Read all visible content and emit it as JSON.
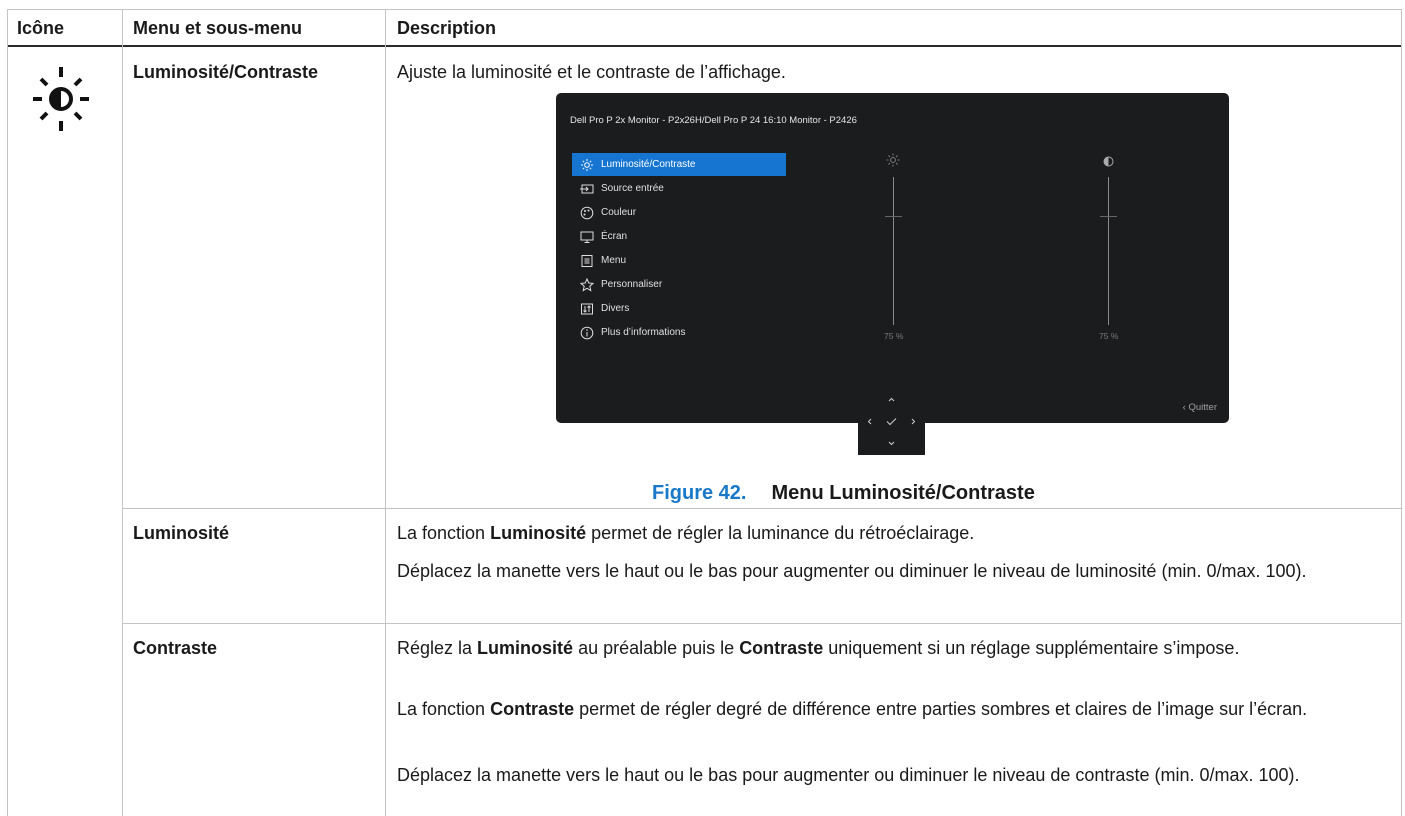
{
  "header": {
    "col_icon": "Icône",
    "col_menu": "Menu et sous-menu",
    "col_desc": "Description"
  },
  "row1": {
    "menu": "Luminosité/Contraste",
    "desc": "Ajuste la luminosité et le contraste de l’affichage.",
    "icon": "brightness-contrast-icon"
  },
  "osd": {
    "model": "Dell Pro P 2x Monitor - P2x26H/Dell Pro P 24 16:10 Monitor - P2426",
    "items": [
      {
        "label": "Luminosité/Contraste",
        "icon": "brightness-icon",
        "selected": true
      },
      {
        "label": "Source entrée",
        "icon": "input-source-icon"
      },
      {
        "label": "Couleur",
        "icon": "palette-icon"
      },
      {
        "label": "Écran",
        "icon": "display-icon"
      },
      {
        "label": "Menu",
        "icon": "menu-icon"
      },
      {
        "label": "Personnaliser",
        "icon": "star-icon"
      },
      {
        "label": "Divers",
        "icon": "others-icon"
      },
      {
        "label": "Plus d’informations",
        "icon": "info-icon"
      }
    ],
    "brightness_value": "75 %",
    "contrast_value": "75 %",
    "brightness_level": 0.75,
    "contrast_level": 0.75,
    "quit_label": "Quitter",
    "accent": "#1575d0"
  },
  "figure": {
    "number": "Figure 42.",
    "title": "Menu Luminosité/Contraste"
  },
  "row2": {
    "menu": "Luminosité",
    "p1_pre": "La fonction ",
    "p1_bold": "Luminosité",
    "p1_post": " permet de régler la luminance du rétroéclairage.",
    "p2": "Déplacez la manette vers le haut ou le bas pour augmenter ou diminuer le niveau de luminosité (min. 0/max. 100)."
  },
  "row3": {
    "menu": "Contraste",
    "p1_a": "Réglez la ",
    "p1_b": "Luminosité",
    "p1_c": " au préalable puis le ",
    "p1_d": "Contraste",
    "p1_e": " uniquement si un réglage supplémentaire s’impose.",
    "p2_a": "La fonction ",
    "p2_b": "Contraste",
    "p2_c": " permet de régler degré de différence entre parties sombres et claires de l’image sur l’écran.",
    "p3": "Déplacez la manette vers le haut ou le bas pour augmenter ou diminuer le niveau de contraste (min. 0/max. 100)."
  }
}
